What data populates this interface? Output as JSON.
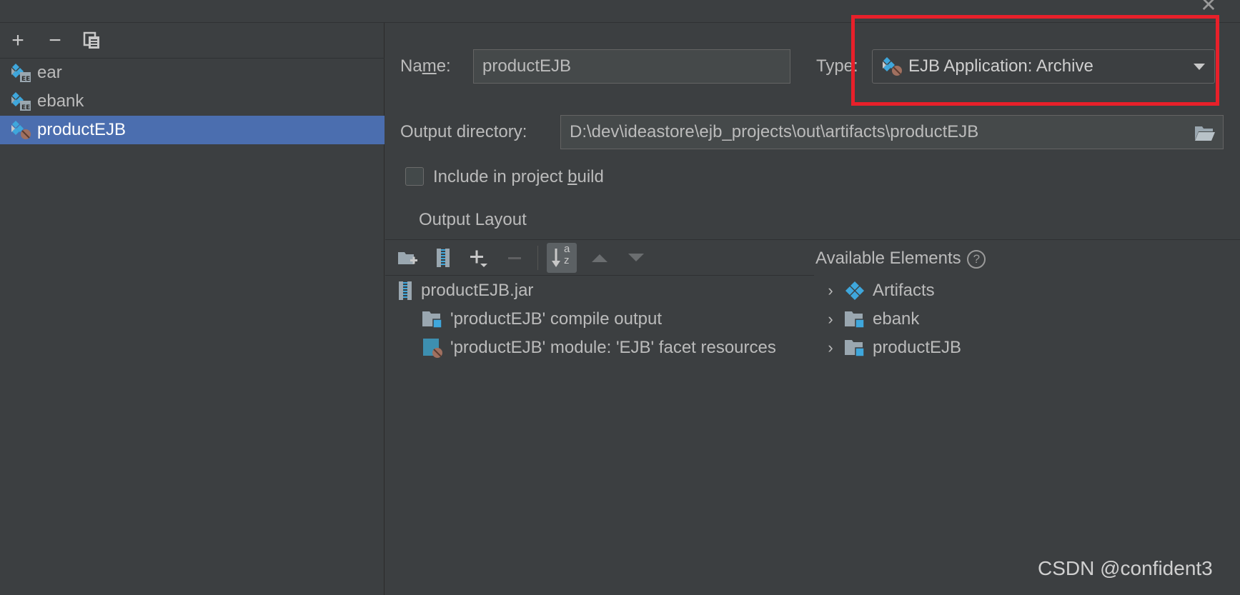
{
  "window": {
    "close_label": "✕"
  },
  "left_toolbar": {
    "add_label": "+",
    "remove_label": "−"
  },
  "artifacts": [
    {
      "label": "ear",
      "icon": "ear-artifact-icon",
      "selected": false
    },
    {
      "label": "ebank",
      "icon": "ear-artifact-icon",
      "selected": false
    },
    {
      "label": "productEJB",
      "icon": "ejb-artifact-icon",
      "selected": true
    }
  ],
  "form": {
    "name_label_pre": "Na",
    "name_label_mnemonic": "m",
    "name_label_post": "e:",
    "name_value": "productEJB",
    "type_label": "Type:",
    "type_value": "EJB Application: Archive",
    "output_dir_label": "Output directory:",
    "output_dir_value": "D:\\dev\\ideastore\\ejb_projects\\out\\artifacts\\productEJB",
    "include_label_pre": "Include in project ",
    "include_label_mnemonic": "b",
    "include_label_post": "uild",
    "include_checked": false,
    "output_layout_tab": "Output Layout"
  },
  "output_tree": [
    {
      "label": "productEJB.jar",
      "icon": "jar-icon",
      "indent": 0
    },
    {
      "label": "'productEJB' compile output",
      "icon": "module-folder-icon",
      "indent": 1
    },
    {
      "label": "'productEJB' module: 'EJB' facet resources",
      "icon": "ejb-facet-icon",
      "indent": 1
    }
  ],
  "available": {
    "header": "Available Elements",
    "help_icon": "?",
    "items": [
      {
        "label": "Artifacts",
        "icon": "artifacts-icon"
      },
      {
        "label": "ebank",
        "icon": "module-folder-icon"
      },
      {
        "label": "productEJB",
        "icon": "module-folder-icon"
      }
    ]
  },
  "layout_toolbar": {
    "sort_label_top": "a",
    "sort_label_bottom": "z"
  },
  "watermark": "CSDN @confident3",
  "colors": {
    "background": "#3c3f41",
    "selection": "#4b6eaf",
    "highlight_box": "#e8202a",
    "icon_blue": "#3fa7dc"
  }
}
